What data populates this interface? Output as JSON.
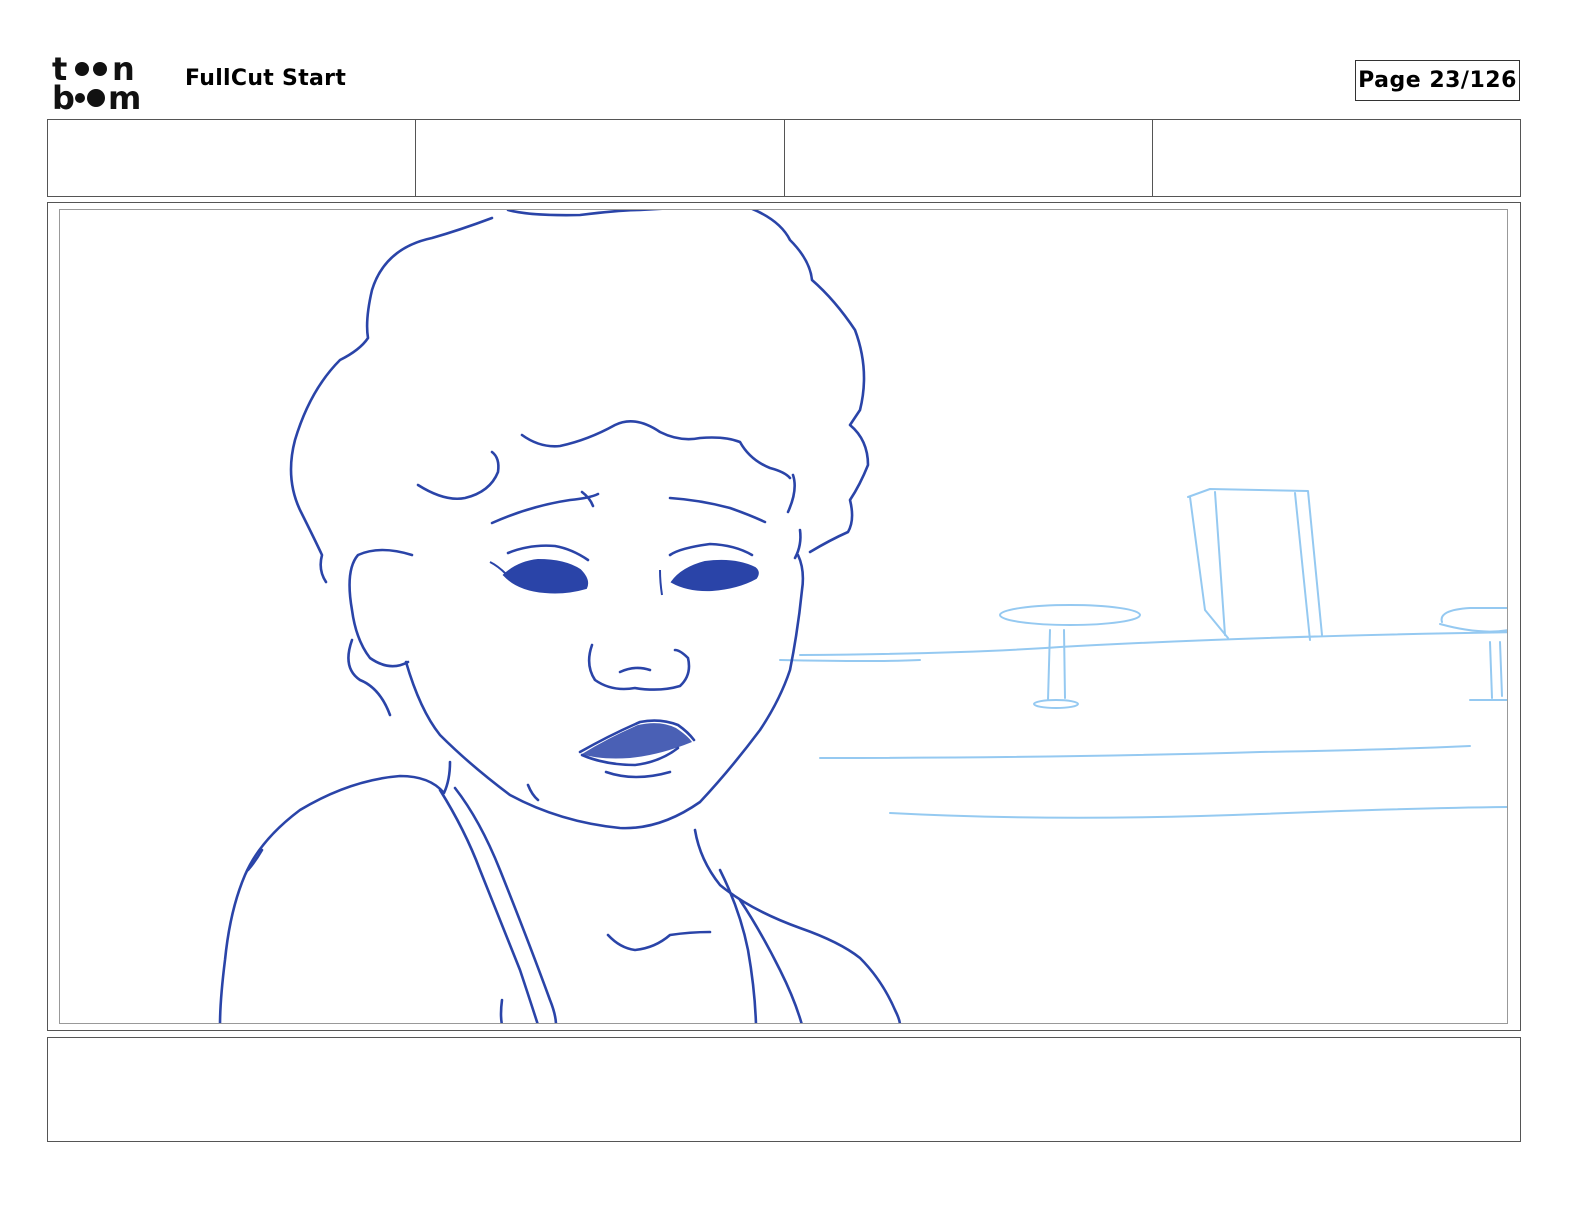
{
  "header": {
    "logo_text": [
      "t",
      "n",
      "b",
      "m"
    ],
    "project_title": "FullCut Start",
    "page_label": "Page 23/126"
  },
  "info_row": {
    "cells": [
      "",
      "",
      "",
      ""
    ]
  },
  "panel": {
    "description_lines": "",
    "line_color": "#2a44a8",
    "background_sketch_color": "#8ac4f0"
  },
  "dialogue_box": {
    "text": ""
  }
}
